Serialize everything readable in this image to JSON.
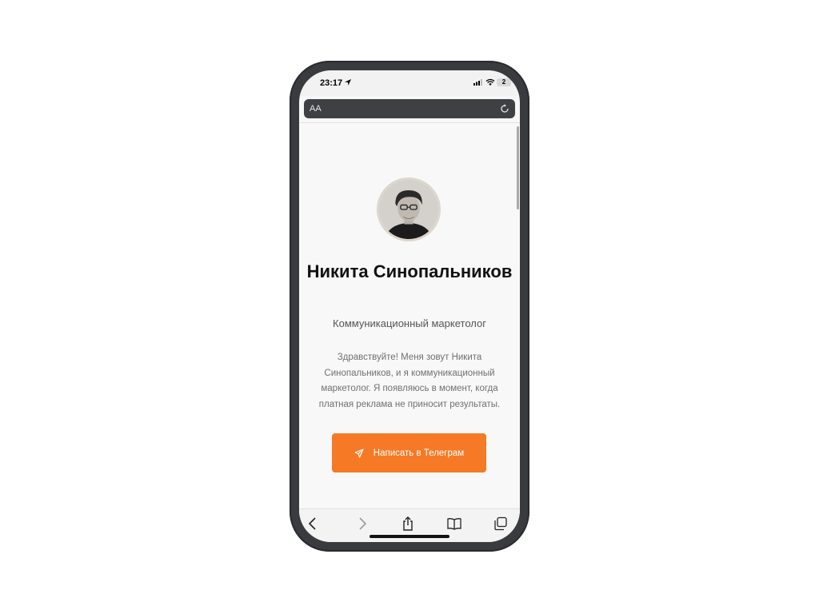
{
  "status_bar": {
    "time": "23:17",
    "battery": "2"
  },
  "browser": {
    "text_size_label": "AA"
  },
  "profile": {
    "name": "Никита Синопальников",
    "role": "Коммуникационный маркетолог",
    "bio": "Здравствуйте! Меня зовут Никита Синопальников, и я коммуникационный маркетолог. Я появляюсь в момент, когда платная реклама не приносит результаты.",
    "cta_label": "Написать в Телеграм",
    "cta_icon": "send-icon"
  },
  "toolbar": {
    "items": [
      "back-icon",
      "forward-icon",
      "share-icon",
      "bookmarks-icon",
      "tabs-icon"
    ]
  },
  "colors": {
    "accent": "#f67925",
    "frame": "#3a3b3f",
    "address_bar": "#3f4043"
  }
}
